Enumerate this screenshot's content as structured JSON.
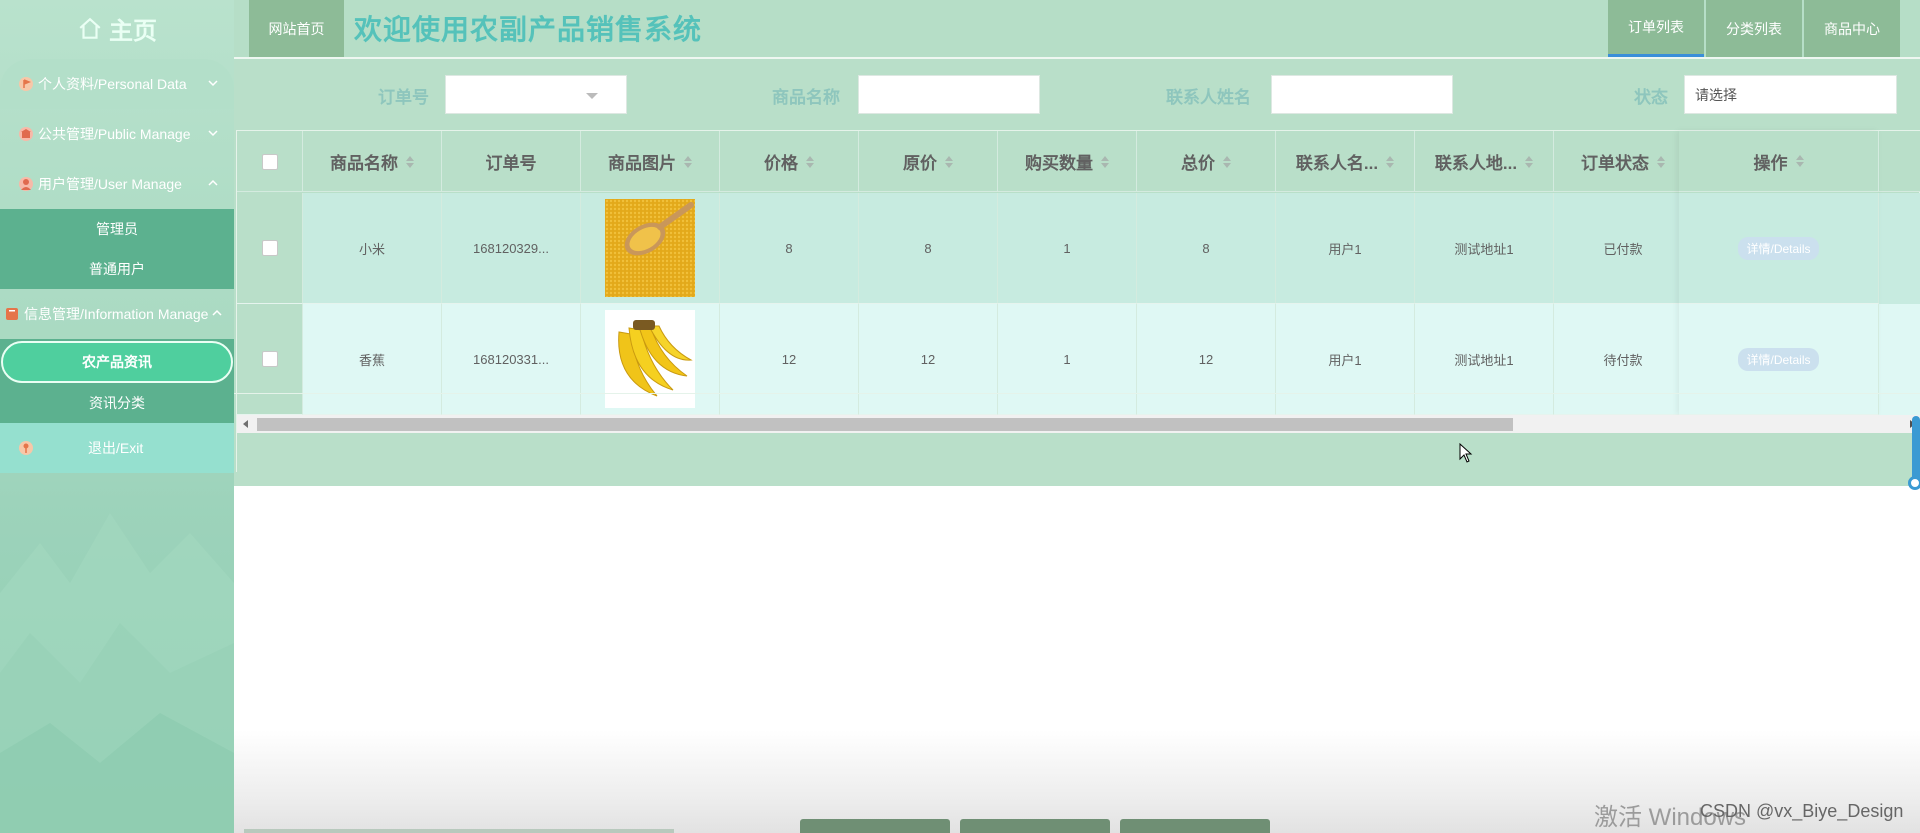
{
  "brand": {
    "label": "主页",
    "icon": "home-icon"
  },
  "sidebar": {
    "items": [
      {
        "label": "个人资料/Personal Data",
        "icon": "flag-icon"
      },
      {
        "label": "公共管理/Public Manage",
        "icon": "building-icon"
      },
      {
        "label": "用户管理/User Manage",
        "icon": "user-icon"
      },
      {
        "label": "信息管理/Information Manage",
        "icon": "book-icon"
      }
    ],
    "user_sub": [
      "管理员",
      "普通用户"
    ],
    "info_sub": [
      "农产品资讯",
      "资讯分类"
    ],
    "exit": {
      "label": "退出/Exit",
      "icon": "pin-icon"
    }
  },
  "header": {
    "home_button": "网站首页",
    "title": "欢迎使用农副产品销售系统",
    "nav": [
      "订单列表",
      "分类列表",
      "商品中心"
    ],
    "active_nav": "订单列表"
  },
  "search": {
    "order_no_label": "订单号",
    "product_name_label": "商品名称",
    "contact_name_label": "联系人姓名",
    "status_label": "状态",
    "status_placeholder": "请选择",
    "order_no_value": "",
    "product_name_value": "",
    "contact_name_value": ""
  },
  "table": {
    "columns": [
      "商品名称",
      "订单号",
      "商品图片",
      "价格",
      "原价",
      "购买数量",
      "总价",
      "联系人名...",
      "联系人地...",
      "订单状态",
      "",
      "操作"
    ],
    "rows": [
      {
        "name": "小米",
        "order_no": "168120329...",
        "image": "millet",
        "price": "8",
        "original_price": "8",
        "qty": "1",
        "total": "8",
        "contact": "用户1",
        "address": "测试地址1",
        "status": "已付款",
        "action": "详情/Details"
      },
      {
        "name": "香蕉",
        "order_no": "168120331...",
        "image": "banana",
        "price": "12",
        "original_price": "12",
        "qty": "1",
        "total": "12",
        "contact": "用户1",
        "address": "测试地址1",
        "status": "待付款",
        "action": "详情/Details"
      }
    ]
  },
  "watermark": {
    "windows": "激活 Windows",
    "csdn": "CSDN @vx_Biye_Design"
  }
}
